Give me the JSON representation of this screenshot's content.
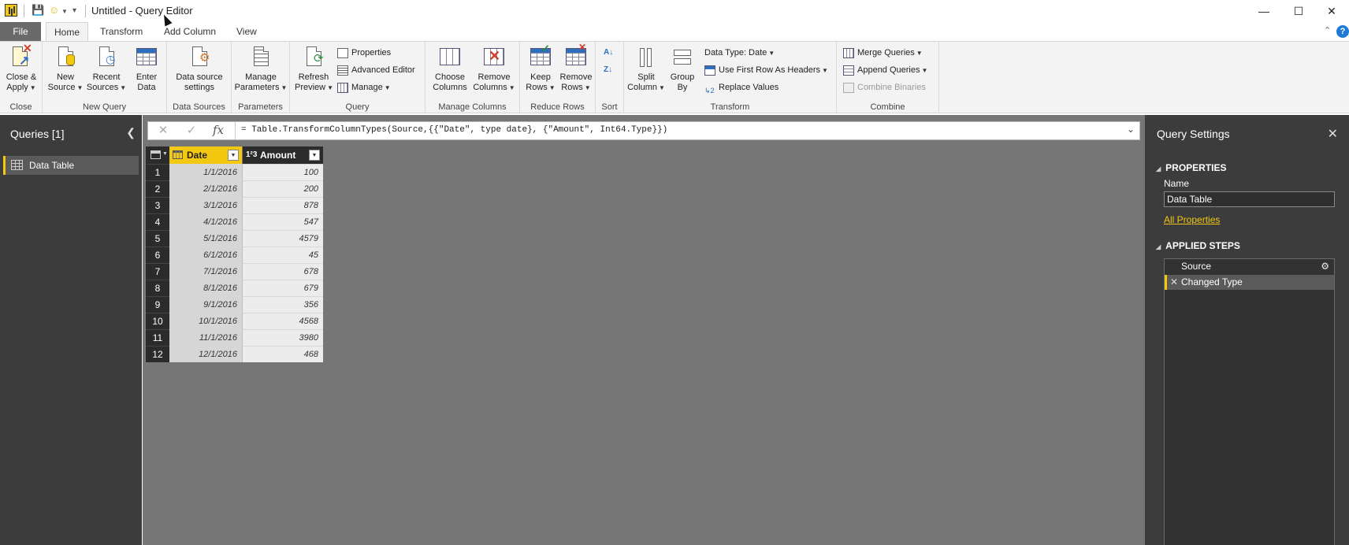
{
  "window": {
    "title": "Untitled - Query Editor",
    "controls": {
      "minimize": "—",
      "maximize": "☐",
      "close": "✕"
    }
  },
  "tabs": [
    {
      "label": "File"
    },
    {
      "label": "Home"
    },
    {
      "label": "Transform"
    },
    {
      "label": "Add Column"
    },
    {
      "label": "View"
    }
  ],
  "ribbon": {
    "groups": {
      "close": {
        "label": "Close",
        "close_apply": "Close &",
        "close_apply_2": "Apply"
      },
      "new_query": {
        "label": "New Query",
        "new_source": "New",
        "new_source_2": "Source",
        "recent_sources": "Recent",
        "recent_sources_2": "Sources",
        "enter_data": "Enter",
        "enter_data_2": "Data"
      },
      "data_sources": {
        "label": "Data Sources",
        "settings": "Data source",
        "settings_2": "settings"
      },
      "parameters": {
        "label": "Parameters",
        "manage": "Manage",
        "manage_2": "Parameters"
      },
      "query": {
        "label": "Query",
        "refresh": "Refresh",
        "refresh_2": "Preview",
        "properties": "Properties",
        "advanced_editor": "Advanced Editor",
        "manage": "Manage"
      },
      "manage_columns": {
        "label": "Manage Columns",
        "choose": "Choose",
        "choose_2": "Columns",
        "remove": "Remove",
        "remove_2": "Columns"
      },
      "reduce_rows": {
        "label": "Reduce Rows",
        "keep": "Keep",
        "keep_2": "Rows",
        "remove": "Remove",
        "remove_2": "Rows"
      },
      "sort": {
        "label": "Sort"
      },
      "transform": {
        "label": "Transform",
        "split": "Split",
        "split_2": "Column",
        "group": "Group",
        "group_2": "By",
        "data_type": "Data Type: Date",
        "first_row": "Use First Row As Headers",
        "replace": "Replace Values"
      },
      "combine": {
        "label": "Combine",
        "merge": "Merge Queries",
        "append": "Append Queries",
        "binaries": "Combine Binaries"
      }
    }
  },
  "queries_pane": {
    "title": "Queries [1]",
    "items": [
      {
        "label": "Data Table"
      }
    ]
  },
  "formula_bar": {
    "text": "= Table.TransformColumnTypes(Source,{{\"Date\", type date}, {\"Amount\", Int64.Type}})"
  },
  "table": {
    "columns": [
      {
        "name": "Date",
        "type_icon": "calendar-icon"
      },
      {
        "name": "Amount",
        "type_icon": "1²3"
      }
    ],
    "rows": [
      {
        "n": "1",
        "date": "1/1/2016",
        "amount": "100"
      },
      {
        "n": "2",
        "date": "2/1/2016",
        "amount": "200"
      },
      {
        "n": "3",
        "date": "3/1/2016",
        "amount": "878"
      },
      {
        "n": "4",
        "date": "4/1/2016",
        "amount": "547"
      },
      {
        "n": "5",
        "date": "5/1/2016",
        "amount": "4579"
      },
      {
        "n": "6",
        "date": "6/1/2016",
        "amount": "45"
      },
      {
        "n": "7",
        "date": "7/1/2016",
        "amount": "678"
      },
      {
        "n": "8",
        "date": "8/1/2016",
        "amount": "679"
      },
      {
        "n": "9",
        "date": "9/1/2016",
        "amount": "356"
      },
      {
        "n": "10",
        "date": "10/1/2016",
        "amount": "4568"
      },
      {
        "n": "11",
        "date": "11/1/2016",
        "amount": "3980"
      },
      {
        "n": "12",
        "date": "12/1/2016",
        "amount": "468"
      }
    ]
  },
  "settings_pane": {
    "title": "Query Settings",
    "properties_header": "PROPERTIES",
    "name_label": "Name",
    "name_value": "Data Table",
    "all_properties": "All Properties",
    "applied_steps_header": "APPLIED STEPS",
    "steps": [
      {
        "label": "Source"
      },
      {
        "label": "Changed Type"
      }
    ]
  },
  "colors": {
    "accent": "#f2c811",
    "pane_dark": "#3c3c3c",
    "grid_area": "#767676"
  }
}
